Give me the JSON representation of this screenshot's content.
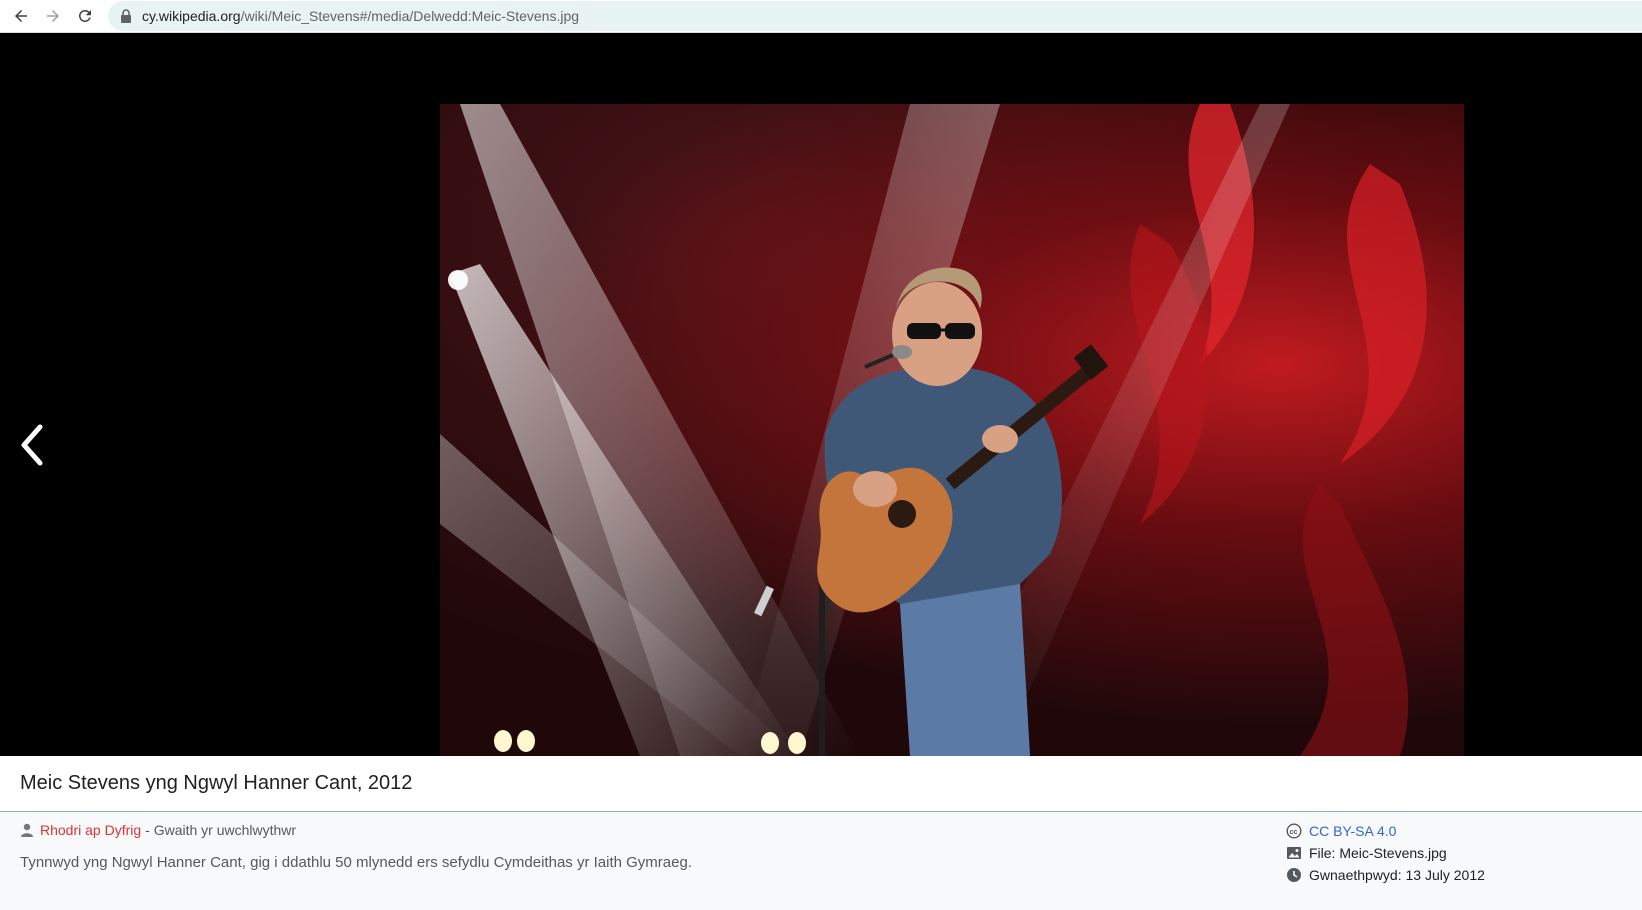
{
  "browser": {
    "url_host": "cy.wikipedia.org",
    "url_path": "/wiki/Meic_Stevens#/media/Delwedd:Meic-Stevens.jpg"
  },
  "media": {
    "title": "Meic Stevens yng Ngwyl Hanner Cant, 2012",
    "author_name": "Rhodri ap Dyfrig",
    "author_role": "- Gwaith yr uwchlwythwr",
    "description": "Tynnwyd yng Ngwyl Hanner Cant, gig i ddathlu 50 mlynedd ers sefydlu Cymdeithas yr Iaith Gymraeg.",
    "license": "CC BY-SA 4.0",
    "file": "File: Meic-Stevens.jpg",
    "date": "Gwnaethpwyd: 13 July 2012"
  },
  "icons": {
    "back": "back-arrow-icon",
    "forward": "forward-arrow-icon",
    "reload": "reload-icon",
    "lock": "lock-icon",
    "prev": "chevron-left-icon",
    "user": "user-icon",
    "cc": "cc-icon",
    "file": "image-file-icon",
    "clock": "clock-icon"
  },
  "colors": {
    "viewer_bg": "#000000",
    "link_red": "#dd3333",
    "link_blue": "#3366cc"
  }
}
